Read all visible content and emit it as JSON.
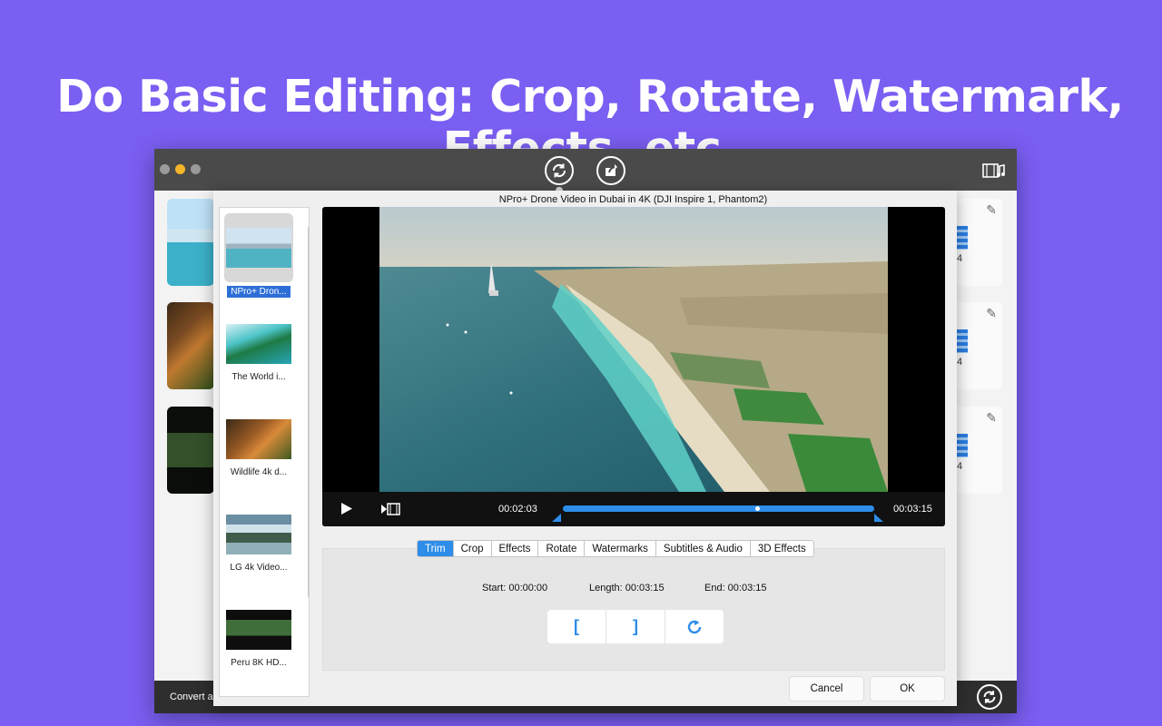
{
  "headline": "Do Basic Editing: Crop, Rotate, Watermark, Effects, etc.",
  "window": {
    "bottom_label": "Convert al",
    "card_number": "4"
  },
  "dialog": {
    "video_title": "NPro+ Drone Video in Dubai in 4K (DJI Inspire 1, Phantom2)",
    "playlist": [
      {
        "label": "NPro+ Dron...",
        "active": true
      },
      {
        "label": "The World i..."
      },
      {
        "label": "Wildlife 4k d..."
      },
      {
        "label": "LG 4k Video..."
      },
      {
        "label": "Peru 8K HD..."
      }
    ],
    "player": {
      "current_time": "00:02:03",
      "total_time": "00:03:15",
      "progress": 0.63
    },
    "tabs": [
      "Trim",
      "Crop",
      "Effects",
      "Rotate",
      "Watermarks",
      "Subtitles & Audio",
      "3D Effects"
    ],
    "active_tab": "Trim",
    "trim": {
      "start": "Start: 00:00:00",
      "length": "Length: 00:03:15",
      "end": "End: 00:03:15",
      "set_start_glyph": "[",
      "set_end_glyph": "]"
    },
    "cancel_label": "Cancel",
    "ok_label": "OK"
  },
  "colors": {
    "background": "#7b5ef2",
    "accent": "#2d8de8",
    "titlebar": "#4a4a4a"
  },
  "icons": [
    "convert-icon",
    "share-icon",
    "film-music-icon",
    "pencil-icon",
    "play-icon",
    "clip-icon",
    "stop-icon",
    "reset-icon"
  ]
}
